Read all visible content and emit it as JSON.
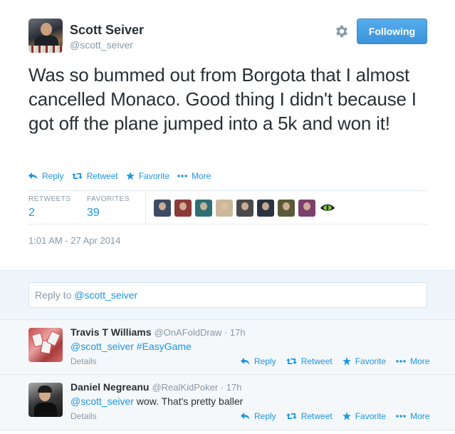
{
  "tweet": {
    "author_name": "Scott Seiver",
    "author_handle": "@scott_seiver",
    "follow_label": "Following",
    "text": "Was so bummed out from Borgota that I almost cancelled Monaco. Good thing I didn't because I got off the plane jumped into a 5k and won it!",
    "actions": {
      "reply": "Reply",
      "retweet": "Retweet",
      "favorite": "Favorite",
      "more": "More"
    },
    "stats": {
      "retweets_label": "RETWEETS",
      "retweets_value": "2",
      "favorites_label": "FAVORITES",
      "favorites_value": "39"
    },
    "favoriter_avatar_colors": [
      "#3d4a63",
      "#8b3a3a",
      "#2f6f74",
      "#c9b89a",
      "#4a4a4a",
      "#2a3342",
      "#5a5a3a",
      "#7a3f6a",
      "#111111"
    ],
    "timestamp": "1:01 AM - 27 Apr 2014"
  },
  "reply_box": {
    "prefix": "Reply to ",
    "mention": "@scott_seiver"
  },
  "replies": [
    {
      "name": "Travis T Williams",
      "handle": "@OnAFoldDraw · 17h",
      "text_link": "@scott_seiver #EasyGame",
      "text_rest": "",
      "details": "Details",
      "reply": "Reply",
      "retweet": "Retweet",
      "favorite": "Favorite",
      "more": "More"
    },
    {
      "name": "Daniel Negreanu",
      "handle": "@RealKidPoker · 17h",
      "text_link": "@scott_seiver",
      "text_rest": " wow. That's pretty baller",
      "details": "Details",
      "reply": "Reply",
      "retweet": "Retweet",
      "favorite": "Favorite",
      "more": "More"
    }
  ],
  "colors": {
    "accent": "#1b95e0",
    "follow_button": "#55acee",
    "muted": "#8899a6"
  }
}
